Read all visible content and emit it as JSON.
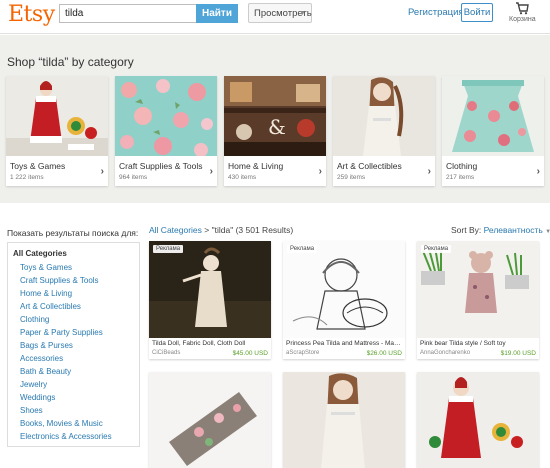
{
  "header": {
    "logo": "Etsy",
    "search_value": "tilda",
    "search_button": "Найти",
    "browse_label": "Просмотреть",
    "register_label": "Регистрация",
    "signin_label": "Войти",
    "cart_label": "Корзина"
  },
  "categories_section": {
    "title": "Shop “tilda” by category",
    "items": [
      {
        "name": "Toys & Games",
        "count": "1 222 items"
      },
      {
        "name": "Craft Supplies & Tools",
        "count": "964 items"
      },
      {
        "name": "Home & Living",
        "count": "430 items"
      },
      {
        "name": "Art & Collectibles",
        "count": "259 items"
      },
      {
        "name": "Clothing",
        "count": "217 items"
      }
    ]
  },
  "sidebar": {
    "filter_label": "Показать результаты поиска для:",
    "all_categories": "All Categories",
    "items": [
      "Toys & Games",
      "Craft Supplies & Tools",
      "Home & Living",
      "Art & Collectibles",
      "Clothing",
      "Paper & Party Supplies",
      "Bags & Purses",
      "Accessories",
      "Bath & Beauty",
      "Jewelry",
      "Weddings",
      "Shoes",
      "Books, Movies & Music",
      "Electronics & Accessories"
    ]
  },
  "results": {
    "crumb_link": "All Categories",
    "crumb_rest": " > \"tilda\" (3 501 Results)",
    "sort_label": "Sort By:",
    "sort_value": "Релевантность",
    "listings": [
      {
        "ad": "Реклама",
        "title": "Tilda Doll, Fabric Doll, Cloth Doll",
        "shop": "CiCiBeads",
        "price": "$45.00 USD"
      },
      {
        "ad": "Реклама",
        "title": "Princess Pea Tilda and Mattress - Mag...",
        "shop": "aScrapStore",
        "price": "$26.00 USD"
      },
      {
        "ad": "Реклама",
        "title": "Pink bear Tilda style / Soft toy",
        "shop": "AnnaGoncharenko",
        "price": "$19.00 USD"
      }
    ]
  },
  "colors": {
    "brand": "#f56400",
    "link": "#2a7ab0",
    "search_button": "#4fa4d8",
    "price": "#5aa02c",
    "band": "#efefec"
  }
}
